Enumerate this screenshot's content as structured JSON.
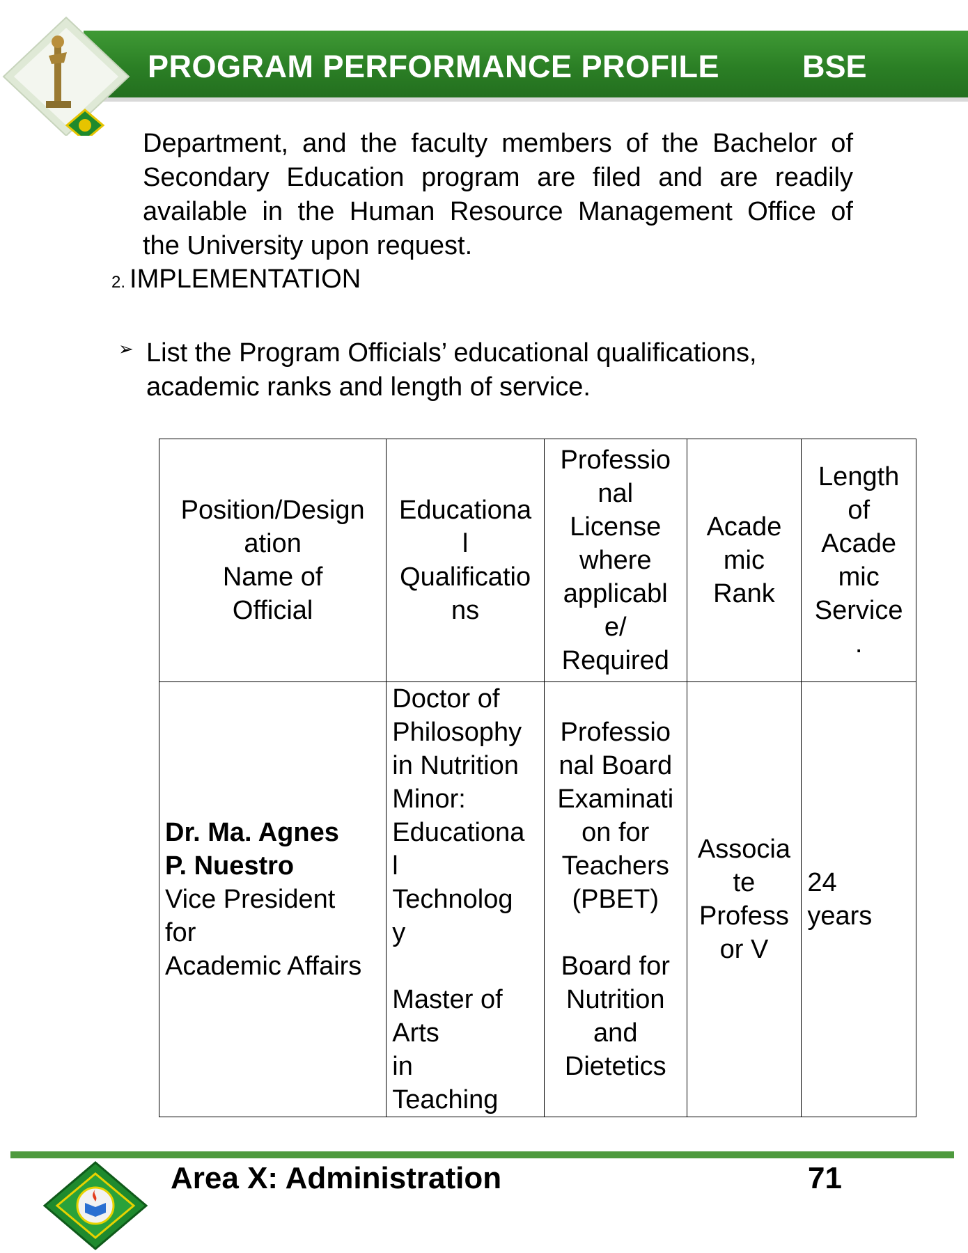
{
  "header": {
    "title": "PROGRAM PERFORMANCE PROFILE",
    "program_code": "BSE"
  },
  "body": {
    "paragraph_lines": [
      "Department, and the faculty members of the Bachelor of",
      "Secondary Education program are filed and are readily",
      "available in the Human Resource Management Office of",
      "the University upon request."
    ],
    "section_number": "2.",
    "section_title": "IMPLEMENTATION",
    "bullet_symbol": "➢",
    "bullet_text": "List the Program Officials’ educational qualifications, academic ranks and length of service."
  },
  "table": {
    "headers": [
      "Position/Design\nation\nName of\nOfficial",
      "Educationa\nl\nQualificatio\nns",
      "Professio\nnal\nLicense\nwhere\napplicabl\ne/\nRequired",
      "Acade\nmic\nRank",
      "Length\nof\nAcade\nmic\nService\n."
    ],
    "rows": [
      {
        "name": "Dr. Ma. Agnes\nP. Nuestro",
        "position": "Vice President\nfor\nAcademic Affairs",
        "education": "Doctor of\nPhilosophy\nin Nutrition\nMinor:\nEducationa\nl\nTechnolog\ny\n\nMaster of\nArts\nin\nTeaching",
        "license": "Professio\nnal Board\nExaminati\non for\nTeachers\n(PBET)\n\nBoard for\nNutrition\nand\nDietetics",
        "rank": "Associa\nte\nProfess\nor V",
        "service": "24\nyears"
      }
    ]
  },
  "footer": {
    "area": "Area X: Administration",
    "page_number": "71"
  },
  "colors": {
    "header_green": "#2b7f25",
    "footer_line": "#4e9a3e"
  }
}
